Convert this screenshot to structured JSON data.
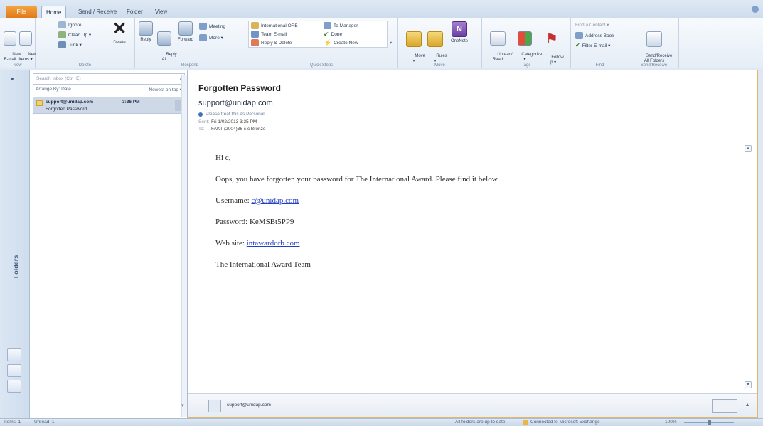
{
  "tabs": {
    "file": "File",
    "home": "Home",
    "send_receive": "Send / Receive",
    "folder": "Folder",
    "view": "View"
  },
  "ribbon": {
    "new": {
      "new_email": "New\nE-mail",
      "new_items": "New\nItems ▾",
      "label": "New"
    },
    "delete": {
      "ignore": "Ignore",
      "clean_up": "Clean Up ▾",
      "junk": "Junk ▾",
      "delete": "Delete",
      "label": "Delete"
    },
    "respond": {
      "reply": "Reply",
      "reply_all": "Reply\nAll",
      "forward": "Forward",
      "meeting": "Meeting",
      "more": "More ▾",
      "label": "Respond"
    },
    "quick_steps": {
      "international": "International ORB",
      "team_email": "Team E-mail",
      "reply_delete": "Reply & Delete",
      "to_manager": "To Manager",
      "done": "Done",
      "create_new": "Create New",
      "label": "Quick Steps"
    },
    "move": {
      "move": "Move\n▾",
      "rules": "Rules\n▾",
      "onenote": "OneNote",
      "label": "Move"
    },
    "tags": {
      "unread_read": "Unread/\nRead",
      "categorize": "Categorize\n▾",
      "follow_up": "Follow\nUp ▾",
      "label": "Tags"
    },
    "find": {
      "find_contact": "Find a Contact ▾",
      "address_book": "Address Book",
      "filter_email": "Filter E-mail ▾",
      "label": "Find"
    },
    "send_receive": {
      "button": "Send/Receive\nAll Folders",
      "label": "Send/Receive"
    }
  },
  "nav": {
    "collapse": "▸",
    "label": "Folders"
  },
  "list": {
    "search_placeholder": "Search Inbox (Ctrl+E)",
    "search_icon": "magnifier-icon",
    "arrange_by": "Arrange By: Date",
    "sort": "Newest on top ▾",
    "message": {
      "from": "support@unidap.com",
      "time": "3:36 PM",
      "subject": "Forgotten Password"
    }
  },
  "reading": {
    "subject": "Forgotten Password",
    "sender": "support@unidap.com",
    "personal_note": "Please treat this as Personal.",
    "sent_label": "Sent:",
    "sent_value": "Fri 1/02/2013 3:35 PM",
    "to_label": "To:",
    "to_value": "FAKT (2004)36 c c Bronze",
    "body": {
      "greeting": "Hi c,",
      "line1": "Oops, you have forgotten your password for The International Award.  Please find it below.",
      "username_label": "Username: ",
      "username_value": "c@unidap.com",
      "password_label": "Password: ",
      "password_value": "KeMSBt5PP9",
      "website_label": "Web site: ",
      "website_value": "intawardorb.com",
      "signoff": "The International Award Team"
    },
    "people_pane_name": "support@unidap.com"
  },
  "status": {
    "items": "Items: 1",
    "unread": "Unread: 1",
    "folders_status": "All folders are up to date.",
    "connection": "Connected to Microsoft Exchange",
    "zoom": "100%"
  },
  "colors": {
    "file_tab": "#e0771b",
    "link": "#2440c2",
    "reading_border": "#e2b76b"
  }
}
